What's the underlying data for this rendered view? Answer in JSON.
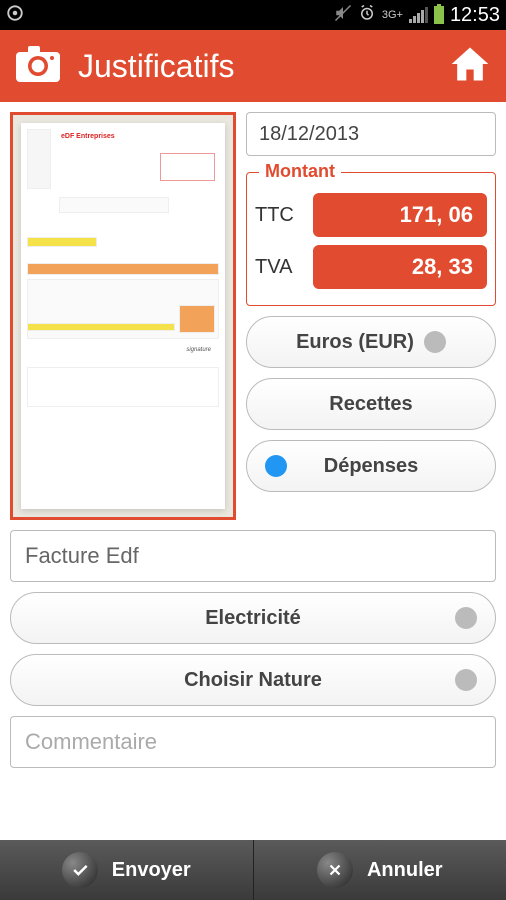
{
  "statusbar": {
    "network_label": "3G+",
    "clock": "12:53"
  },
  "appbar": {
    "title": "Justificatifs"
  },
  "form": {
    "date": "18/12/2013",
    "montant": {
      "legend": "Montant",
      "ttc_label": "TTC",
      "ttc_value": "171, 06",
      "tva_label": "TVA",
      "tva_value": "28, 33"
    },
    "currency_label": "Euros (EUR)",
    "recettes_label": "Recettes",
    "depenses_label": "Dépenses",
    "description": "Facture Edf",
    "category_label": "Electricité",
    "nature_label": "Choisir Nature",
    "comment_placeholder": "Commentaire"
  },
  "bottombar": {
    "send_label": "Envoyer",
    "cancel_label": "Annuler"
  }
}
